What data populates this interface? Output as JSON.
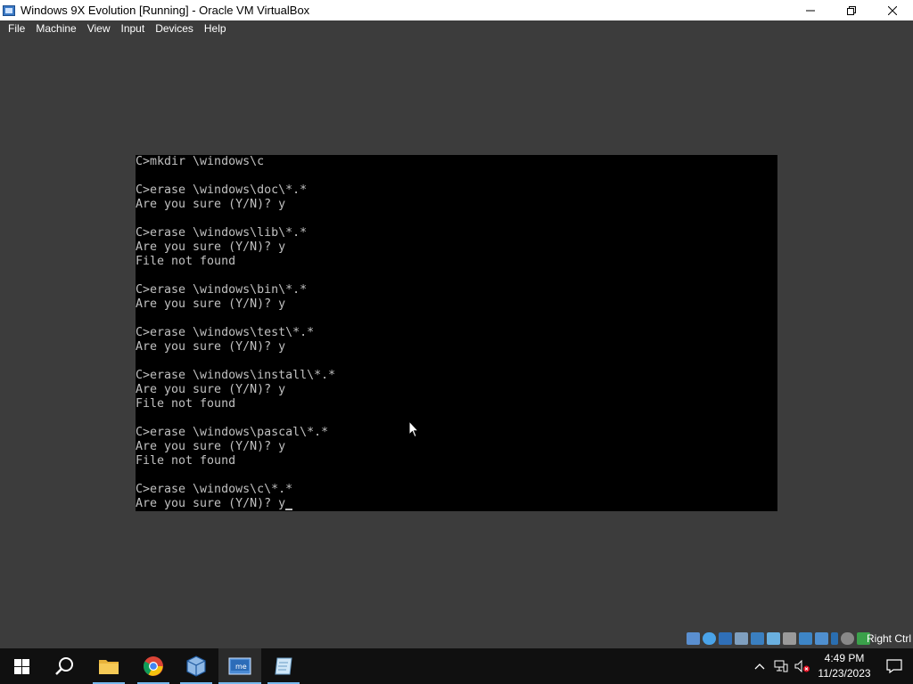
{
  "window": {
    "title": "Windows 9X Evolution [Running] - Oracle VM VirtualBox",
    "icon": "virtualbox-vm-icon",
    "controls": [
      "minimize-icon",
      "restore-icon",
      "close-icon"
    ]
  },
  "menu": {
    "items": [
      "File",
      "Machine",
      "View",
      "Input",
      "Devices",
      "Help"
    ]
  },
  "console": {
    "lines": [
      "C>mkdir \\windows\\c",
      "",
      "C>erase \\windows\\doc\\*.*",
      "Are you sure (Y/N)? y",
      "",
      "C>erase \\windows\\lib\\*.*",
      "Are you sure (Y/N)? y",
      "File not found",
      "",
      "C>erase \\windows\\bin\\*.*",
      "Are you sure (Y/N)? y",
      "",
      "C>erase \\windows\\test\\*.*",
      "Are you sure (Y/N)? y",
      "",
      "C>erase \\windows\\install\\*.*",
      "Are you sure (Y/N)? y",
      "File not found",
      "",
      "C>erase \\windows\\pascal\\*.*",
      "Are you sure (Y/N)? y",
      "File not found",
      "",
      "C>erase \\windows\\c\\*.*",
      "Are you sure (Y/N)? y"
    ],
    "text_color": "#c0c0c0",
    "background": "#000000"
  },
  "statusbar": {
    "icons": [
      "hard-disk-icon",
      "optical-drive-icon",
      "floppy-drive-icon",
      "audio-icon",
      "network-icon",
      "usb-icon",
      "shared-folders-icon",
      "display-icon",
      "video-capture-icon",
      "mouse-integration-icon",
      "cpu-icon",
      "keyboard-icon"
    ],
    "host_key": "Right Ctrl"
  },
  "taskbar": {
    "apps": [
      {
        "name": "start-button",
        "icon": "windows-logo-icon"
      },
      {
        "name": "search-button",
        "icon": "search-icon"
      },
      {
        "name": "file-explorer",
        "icon": "folder-icon"
      },
      {
        "name": "chrome",
        "icon": "chrome-icon"
      },
      {
        "name": "virtualbox-manager",
        "icon": "virtualbox-icon"
      },
      {
        "name": "vm-window-windows-me",
        "icon": "windows-me-vm-icon",
        "active": true
      },
      {
        "name": "notepad-app",
        "icon": "notepad-icon"
      }
    ],
    "tray": {
      "icons": [
        "chevron-up-icon",
        "network-icon",
        "speaker-muted-icon"
      ],
      "time": "4:49 PM",
      "date": "11/23/2023"
    }
  },
  "colors": {
    "vm_background": "#3c3c3c",
    "taskbar": "#101010",
    "accent": "#76b9ed"
  }
}
